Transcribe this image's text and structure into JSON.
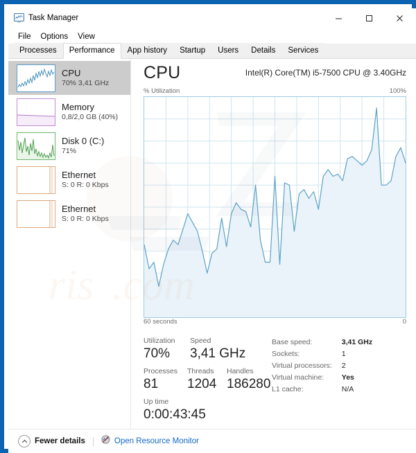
{
  "window": {
    "title": "Task Manager",
    "icon": "task-manager-icon",
    "accent_color": "#0b63b2",
    "controls": {
      "minimize": "–",
      "maximize": "□",
      "close": "✕"
    }
  },
  "menu": {
    "items": [
      {
        "label": "File"
      },
      {
        "label": "Options"
      },
      {
        "label": "View"
      }
    ]
  },
  "tabs": {
    "active": "Performance",
    "items": [
      {
        "label": "Processes",
        "active": false
      },
      {
        "label": "Performance",
        "active": true
      },
      {
        "label": "App history",
        "active": false
      },
      {
        "label": "Startup",
        "active": false
      },
      {
        "label": "Users",
        "active": false
      },
      {
        "label": "Details",
        "active": false
      },
      {
        "label": "Services",
        "active": false
      }
    ]
  },
  "sidebar": {
    "items": [
      {
        "name": "CPU",
        "title": "CPU",
        "subtitle": "70%  3,41 GHz",
        "selected": true,
        "color": "#5a9ec7",
        "thumb": "cpu-sparkline"
      },
      {
        "name": "Memory",
        "title": "Memory",
        "subtitle": "0,8/2,0 GB (40%)",
        "selected": false,
        "color": "#c18bd0",
        "thumb": "memory-sparkline"
      },
      {
        "name": "Disk",
        "title": "Disk 0 (C:)",
        "subtitle": "71%",
        "selected": false,
        "color": "#6cb36c",
        "thumb": "disk-sparkline"
      },
      {
        "name": "Ethernet-1",
        "title": "Ethernet",
        "subtitle_prefix": "S: ",
        "subtitle_send": "0",
        "subtitle_mid": " R: ",
        "subtitle_recv": "0 Kbps",
        "subtitle": "S: 0 R: 0 Kbps",
        "selected": false,
        "color": "#dda87a",
        "thumb": "ethernet-sparkline"
      },
      {
        "name": "Ethernet-2",
        "title": "Ethernet",
        "subtitle": "S: 0 R: 0 Kbps",
        "selected": false,
        "color": "#dda87a",
        "thumb": "ethernet-sparkline"
      }
    ]
  },
  "main": {
    "heading": "CPU",
    "model": "Intel(R) Core(TM) i5-7500 CPU @ 3.40GHz",
    "graph_top_left_label": "% Utilization",
    "graph_top_right_label": "100%",
    "graph_bottom_left_label": "60 seconds",
    "graph_bottom_right_label": "0",
    "line_color": "#5aa2c8",
    "fill_color": "#eaf3fa",
    "grid_color": "#cfe4f0",
    "border_color": "#9fcbe0"
  },
  "stats": {
    "utilization_label": "Utilization",
    "utilization_value": "70%",
    "speed_label": "Speed",
    "speed_value": "3,41 GHz",
    "processes_label": "Processes",
    "processes_value": "81",
    "threads_label": "Threads",
    "threads_value": "1204",
    "handles_label": "Handles",
    "handles_value": "186280",
    "uptime_label": "Up time",
    "uptime_value": "0:00:43:45",
    "details": [
      {
        "label": "Base speed:",
        "value": "3,41 GHz",
        "bold": true
      },
      {
        "label": "Sockets:",
        "value": "1",
        "bold": false
      },
      {
        "label": "Virtual processors:",
        "value": "2",
        "bold": false
      },
      {
        "label": "Virtual machine:",
        "value": "Yes",
        "bold": true
      },
      {
        "label": "L1 cache:",
        "value": "N/A",
        "bold": false
      }
    ]
  },
  "statusbar": {
    "fewer_details_label": "Fewer details",
    "fewer_details_icon": "chevron-up-icon",
    "resource_monitor_label": "Open Resource Monitor",
    "resource_monitor_icon": "resource-monitor-icon",
    "link_color": "#1268c3"
  },
  "chart_data": {
    "type": "area",
    "title": "% Utilization",
    "xlabel": "60 seconds",
    "ylabel": "% Utilization",
    "xlim": [
      60,
      0
    ],
    "ylim": [
      0,
      100
    ],
    "yticks": [
      0,
      100
    ],
    "grid": true,
    "legend": false,
    "series": [
      {
        "name": "CPU Utilization",
        "color": "#5aa2c8",
        "values": [
          33,
          22,
          25,
          14,
          24,
          31,
          35,
          33,
          40,
          47,
          43,
          39,
          30,
          20,
          29,
          31,
          45,
          32,
          47,
          52,
          49,
          48,
          41,
          60,
          35,
          25,
          25,
          64,
          24,
          61,
          60,
          39,
          56,
          58,
          54,
          57,
          49,
          64,
          67,
          64,
          65,
          62,
          72,
          73,
          71,
          69,
          71,
          76,
          95,
          60,
          60,
          62,
          73,
          77,
          70
        ]
      }
    ]
  }
}
